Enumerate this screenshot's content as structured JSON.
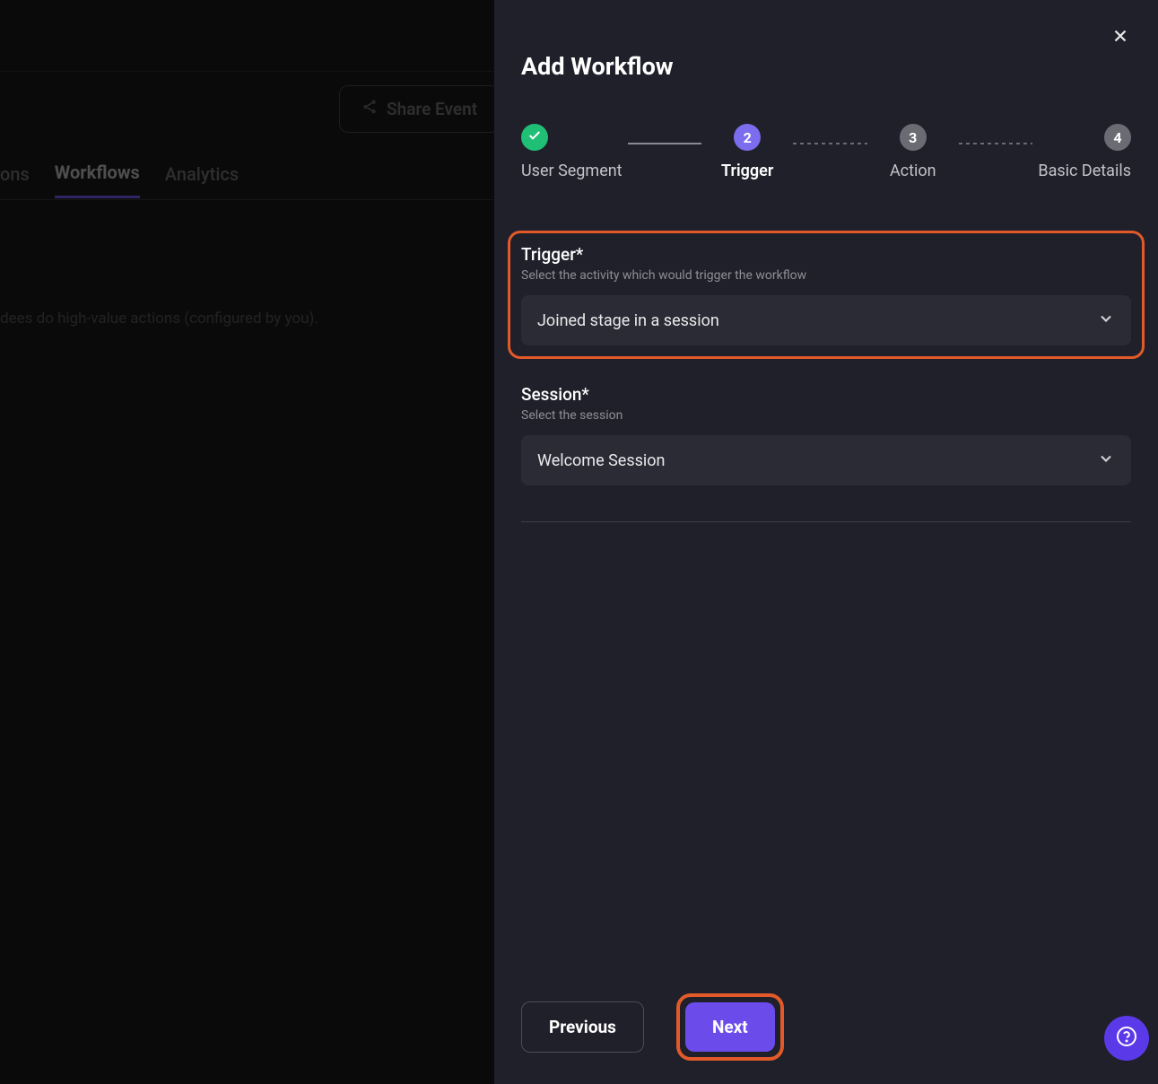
{
  "background": {
    "share_label": "Share Event",
    "tabs": [
      "ons",
      "Workflows",
      "Analytics"
    ],
    "description": "dees do high-value actions (configured by you)."
  },
  "drawer": {
    "title": "Add Workflow",
    "steps": [
      {
        "label": "User Segment"
      },
      {
        "num": "2",
        "label": "Trigger"
      },
      {
        "num": "3",
        "label": "Action"
      },
      {
        "num": "4",
        "label": "Basic Details"
      }
    ],
    "trigger": {
      "label": "Trigger*",
      "help": "Select the activity which would trigger the workflow",
      "value": "Joined stage in a session"
    },
    "session": {
      "label": "Session*",
      "help": "Select the session",
      "value": "Welcome Session"
    },
    "footer": {
      "previous": "Previous",
      "next": "Next"
    }
  }
}
